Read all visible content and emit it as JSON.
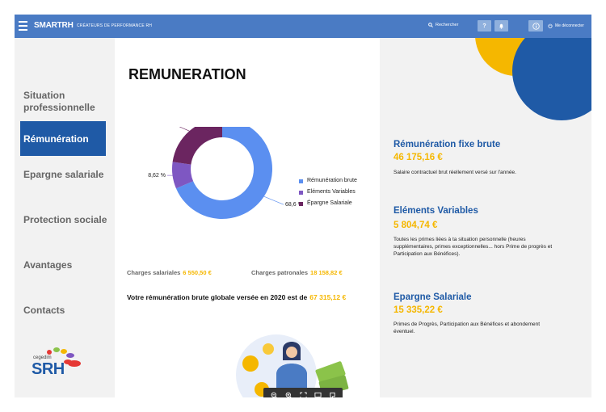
{
  "header": {
    "logo": "SMARTRH",
    "tagline": "CRÉATEURS DE PERFORMANCE RH",
    "search_label": "Rechercher",
    "help_label": "?",
    "logout_label": "Me déconnecter"
  },
  "sidebar": {
    "items": [
      {
        "label": "Situation professionnelle"
      },
      {
        "label": "Rémunération"
      },
      {
        "label": "Epargne salariale"
      },
      {
        "label": "Protection sociale"
      },
      {
        "label": "Avantages"
      },
      {
        "label": "Contacts"
      }
    ],
    "active_index": 1,
    "brand_small": "cegedim",
    "brand_big": "SRH"
  },
  "main": {
    "title": "REMUNERATION",
    "charges_salariales_label": "Charges salariales",
    "charges_salariales_value": "6 550,50 €",
    "charges_patronales_label": "Charges patronales",
    "charges_patronales_value": "18 158,82 €",
    "total_label": "Votre rémunération brute globale versée en 2020 est de",
    "total_value": "67 315,12 €"
  },
  "chart_data": {
    "type": "pie",
    "donut": true,
    "categories": [
      "Rémunération brute",
      "Eléments Variables",
      "Épargne Salariale"
    ],
    "values": [
      68.6,
      8.62,
      22.78
    ],
    "labels": [
      "68,6 %",
      "8,62 %",
      "22,78 %"
    ],
    "colors": [
      "#5b8ff0",
      "#7e57c2",
      "#6b2560"
    ],
    "legend_position": "right"
  },
  "right_panel": {
    "sections": [
      {
        "title": "Rémunération fixe brute",
        "value": "46 175,16 €",
        "desc": "Salaire contractuel brut réellement versé sur l'année."
      },
      {
        "title": "Eléments Variables",
        "value": "5 804,74 €",
        "desc": "Toutes les primes liées à ta situation personnelle (heures supplémentaires, primes exceptionnelles... hors Prime de progrès et Participation aux Bénéfices)."
      },
      {
        "title": "Epargne Salariale",
        "value": "15 335,22 €",
        "desc": "Primes de Progrès, Participation aux Bénéfices et abondement éventuel."
      }
    ]
  },
  "colors": {
    "header_blue": "#4a7bc4",
    "active_blue": "#1f5aa6",
    "accent_yellow": "#f5b700"
  }
}
